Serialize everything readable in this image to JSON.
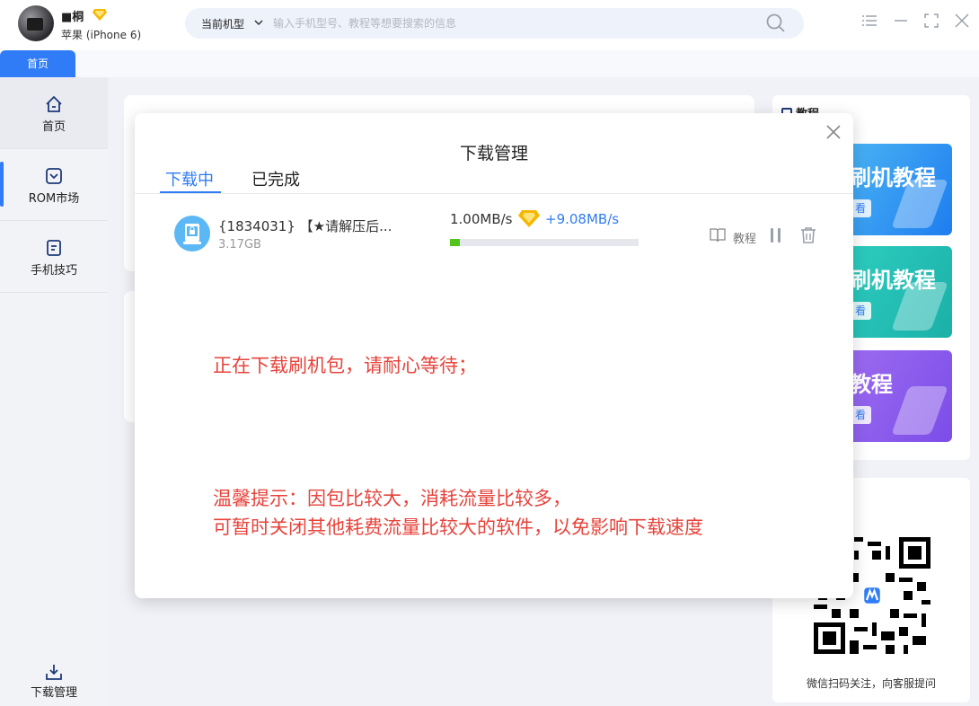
{
  "user": {
    "name": "■桐",
    "device": "苹果 (iPhone 6)"
  },
  "search": {
    "model_selector": "当前机型",
    "placeholder": "输入手机型号、教程等想要搜索的信息"
  },
  "tabs": {
    "home": "首页"
  },
  "sidebar": {
    "items": [
      {
        "label": "首页",
        "icon": "home-icon"
      },
      {
        "label": "ROM市场",
        "icon": "rom-market-icon"
      },
      {
        "label": "手机技巧",
        "icon": "phone-tips-icon"
      }
    ],
    "download": "下载管理"
  },
  "right_panel": {
    "title": "教程",
    "cards": [
      {
        "title": "刷机教程",
        "button": "看"
      },
      {
        "title": "刷机教程",
        "button": "看"
      },
      {
        "title": "教程",
        "button": "看"
      }
    ],
    "qr_caption": "微信扫码关注，向客服提问"
  },
  "modal": {
    "title": "下载管理",
    "tab_downloading": "下载中",
    "tab_finished": "已完成",
    "item": {
      "name": "{1834031} 【★请解压后...",
      "size": "3.17GB",
      "speed": "1.00MB/s",
      "vip_speed": "+9.08MB/s",
      "progress_percent": 5,
      "tutorial_label": "教程"
    },
    "note_downloading": "正在下载刷机包，请耐心等待；",
    "note_tip_1": "温馨提示：因包比较大，消耗流量比较多，",
    "note_tip_2": "可暂时关闭其他耗费流量比较大的软件，以免影响下载速度"
  },
  "colors": {
    "accent": "#2f7cf6",
    "progress": "#52c41a",
    "note": "#e6433b",
    "vip": "#f5b800"
  }
}
